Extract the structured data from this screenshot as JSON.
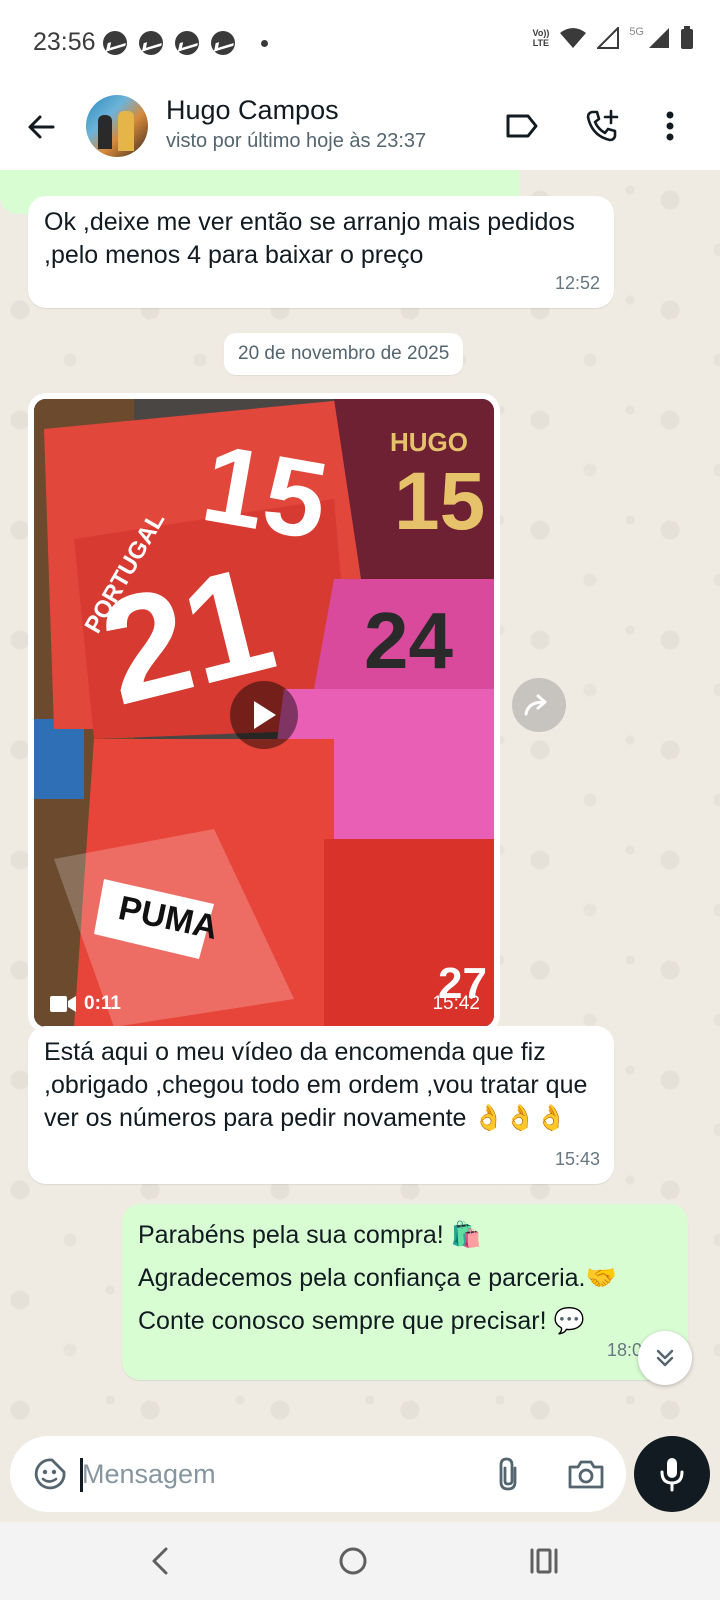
{
  "status_bar": {
    "time": "23:56",
    "network_label_top": "Vo))",
    "network_label_bottom": "LTE",
    "generation": "5G"
  },
  "header": {
    "contact_name": "Hugo Campos",
    "last_seen": "visto por último hoje às 23:37"
  },
  "messages": [
    {
      "direction": "incoming",
      "text": "Ok ,deixe me ver então se arranjo mais pedidos ,pelo menos 4 para baixar o preço",
      "time": "12:52"
    },
    {
      "type": "date_separator",
      "text": "20 de novembro de 2025"
    },
    {
      "direction": "incoming",
      "type": "video",
      "duration": "0:11",
      "time": "15:42"
    },
    {
      "direction": "incoming",
      "text": "Está aqui o meu vídeo da encomenda que fiz ,obrigado ,chegou todo em ordem ,vou tratar que ver os números para pedir novamente 👌👌👌",
      "time": "15:43"
    },
    {
      "direction": "outgoing",
      "lines": [
        "Parabéns pela sua compra! 🛍️",
        "Agradecemos pela confiança e parceria.🤝",
        "Conte conosco sempre que precisar! 💬"
      ],
      "time": "18:01"
    }
  ],
  "video_print": {
    "shirt1_name": "PORTUGAL",
    "shirt1_number": "21",
    "shirt1_number2": "15",
    "shirt2_name": "HUGO",
    "shirt2_number": "15",
    "shirt3_number": "24",
    "puma_tag": "PUMA",
    "shirt4_number": "27"
  },
  "input": {
    "placeholder": "Mensagem"
  },
  "colors": {
    "chat_background": "#efeae2",
    "incoming_bubble": "#ffffff",
    "outgoing_bubble": "#d9fdd3",
    "mic_button": "#111b21"
  }
}
